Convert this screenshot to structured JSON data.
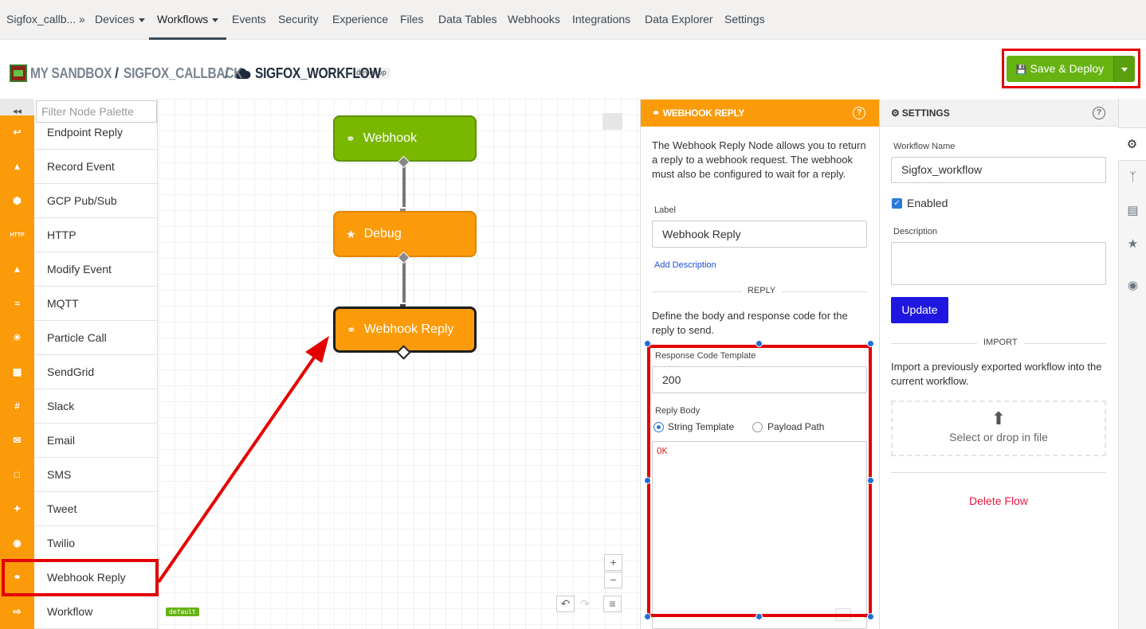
{
  "topnav": {
    "app": "Sigfox_callb... »",
    "items": [
      "Devices",
      "Workflows",
      "Events",
      "Security",
      "Experience",
      "Files",
      "Data Tables",
      "Webhooks",
      "Integrations",
      "Data Explorer",
      "Settings"
    ]
  },
  "header": {
    "crumb1": "MY SANDBOX",
    "crumb2": "SIGFOX_CALLBACK",
    "crumb3": "SIGFOX_WORKFLOW",
    "separator": "/",
    "branch": "develop",
    "deploy_label": "Save & Deploy"
  },
  "palette": {
    "collapse": "◂◂",
    "filter_placeholder": "Filter Node Palette",
    "items": [
      {
        "label": "Endpoint Reply",
        "icon": "reply-icon"
      },
      {
        "label": "Record Event",
        "icon": "record-event-icon"
      },
      {
        "label": "GCP Pub/Sub",
        "icon": "gcp-icon"
      },
      {
        "label": "HTTP",
        "icon": "http-icon"
      },
      {
        "label": "Modify Event",
        "icon": "modify-event-icon"
      },
      {
        "label": "MQTT",
        "icon": "mqtt-icon"
      },
      {
        "label": "Particle Call",
        "icon": "particle-icon"
      },
      {
        "label": "SendGrid",
        "icon": "sendgrid-icon"
      },
      {
        "label": "Slack",
        "icon": "slack-icon"
      },
      {
        "label": "Email",
        "icon": "email-icon"
      },
      {
        "label": "SMS",
        "icon": "sms-icon"
      },
      {
        "label": "Tweet",
        "icon": "twitter-icon"
      },
      {
        "label": "Twilio",
        "icon": "twilio-icon"
      },
      {
        "label": "Webhook Reply",
        "icon": "link-icon"
      },
      {
        "label": "Workflow",
        "icon": "workflow-icon"
      }
    ],
    "http_icon_text": "HTTP"
  },
  "canvas": {
    "nodes": [
      {
        "label": "Webhook",
        "color": "#7ab800"
      },
      {
        "label": "Debug",
        "color": "#fb9b0a"
      },
      {
        "label": "Webhook Reply",
        "color": "#fb9b0a"
      }
    ],
    "zoom_in": "+",
    "zoom_out": "−",
    "default_tag": "default"
  },
  "webhook_reply_panel": {
    "title": "WEBHOOK REPLY",
    "description": "The Webhook Reply Node allows you to return a reply to a webhook request. The webhook must also be configured to wait for a reply.",
    "label_caption": "Label",
    "label_value": "Webhook Reply",
    "add_description": "Add Description",
    "section_reply": "REPLY",
    "reply_help": "Define the body and response code for the reply to send.",
    "response_code_caption": "Response Code Template",
    "response_code_value": "200",
    "reply_body_caption": "Reply Body",
    "radio_string": "String Template",
    "radio_payload": "Payload Path",
    "body_value": "OK"
  },
  "settings_panel": {
    "title": "SETTINGS",
    "workflow_name_caption": "Workflow Name",
    "workflow_name_value": "Sigfox_workflow",
    "enabled_label": "Enabled",
    "description_caption": "Description",
    "update_label": "Update",
    "import_section": "IMPORT",
    "import_help": "Import a previously exported workflow into the current workflow.",
    "dropzone_label": "Select or drop in file",
    "delete_label": "Delete Flow"
  },
  "colors": {
    "accent_orange": "#fb9b0a",
    "deploy_green": "#66b312",
    "annotation_red": "#e40000",
    "update_blue": "#1f16e0",
    "delete_red": "#e8173f"
  }
}
